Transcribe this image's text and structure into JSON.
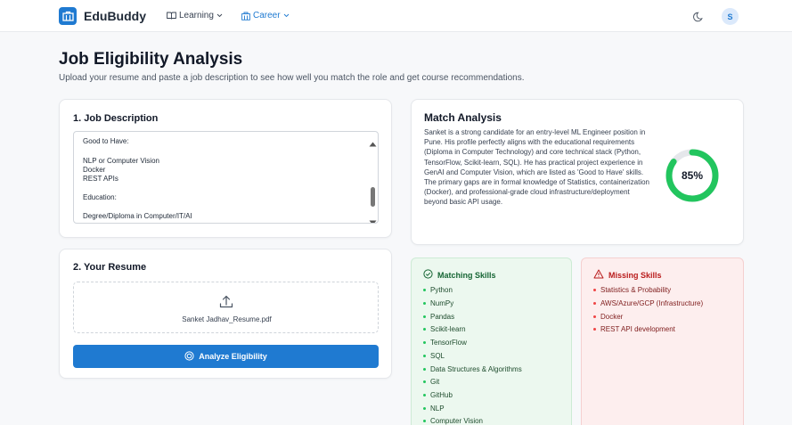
{
  "app": {
    "name": "EduBuddy",
    "nav": [
      {
        "label": "Learning"
      },
      {
        "label": "Career"
      }
    ],
    "avatar_initial": "S"
  },
  "header": {
    "title": "Job Eligibility Analysis",
    "subtitle": "Upload your resume and paste a job description to see how well you match the role and get course recommendations."
  },
  "job_description": {
    "title": "1. Job Description",
    "lines": [
      "Good to Have:",
      "",
      "NLP or Computer Vision",
      "Docker",
      "REST APIs",
      "",
      "Education:",
      "",
      "Degree/Diploma in Computer/IT/AI"
    ]
  },
  "resume": {
    "title": "2. Your Resume",
    "file_name": "Sanket Jadhav_Resume.pdf",
    "analyze_label": "Analyze Eligibility"
  },
  "match": {
    "title": "Match Analysis",
    "summary": "Sanket is a strong candidate for an entry-level ML Engineer position in Pune. His profile perfectly aligns with the educational requirements (Diploma in Computer Technology) and core technical stack (Python, TensorFlow, Scikit-learn, SQL). He has practical project experience in GenAI and Computer Vision, which are listed as 'Good to Have' skills. The primary gaps are in formal knowledge of Statistics, containerization (Docker), and professional-grade cloud infrastructure/deployment beyond basic API usage.",
    "score_label": "85%",
    "score": 85,
    "ring_color": "#22c55e",
    "ring_track": "#e5e7eb"
  },
  "matching_skills": {
    "title": "Matching Skills",
    "items": [
      "Python",
      "NumPy",
      "Pandas",
      "Scikit-learn",
      "TensorFlow",
      "SQL",
      "Data Structures & Algorithms",
      "Git",
      "GitHub",
      "NLP",
      "Computer Vision"
    ]
  },
  "missing_skills": {
    "title": "Missing Skills",
    "items": [
      "Statistics & Probability",
      "AWS/Azure/GCP (Infrastructure)",
      "Docker",
      "REST API development"
    ]
  },
  "colors": {
    "accent": "#1f7ad1",
    "match_green": "#22c55e",
    "missing_red": "#ef4444"
  }
}
